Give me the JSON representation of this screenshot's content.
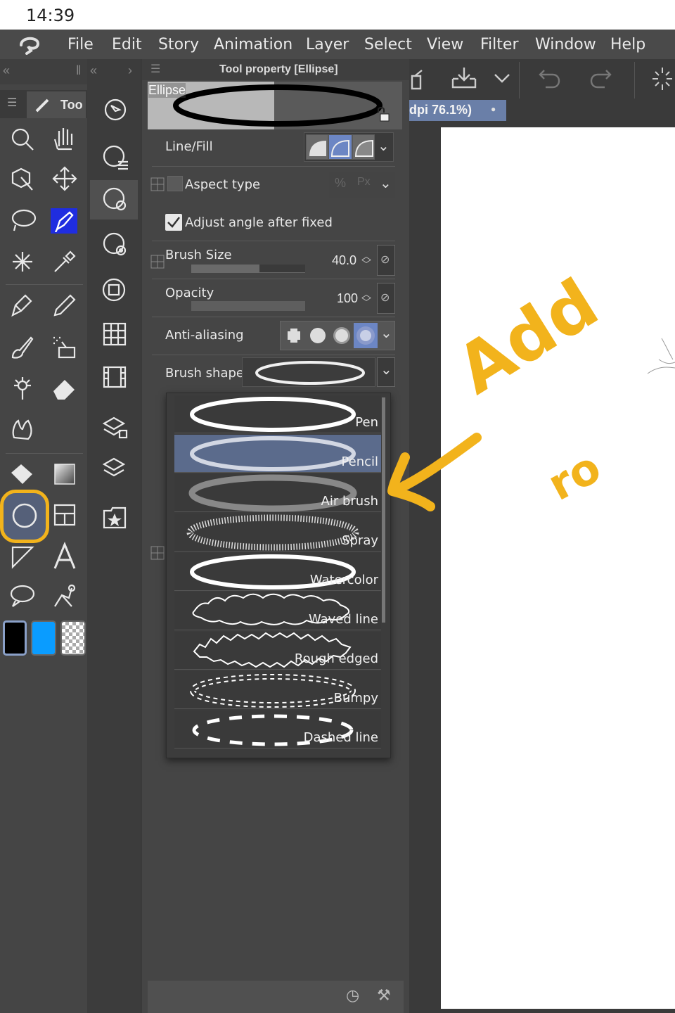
{
  "status_bar": {
    "time": "14:39"
  },
  "menu": {
    "items": [
      "File",
      "Edit",
      "Story",
      "Animation",
      "Layer",
      "Select",
      "View",
      "Filter",
      "Window",
      "Help"
    ]
  },
  "tool_palette": {
    "tab_label": "Too"
  },
  "tool_property": {
    "title": "Tool property [Ellipse]",
    "preview_label": "Ellipse",
    "line_fill_label": "Line/Fill",
    "aspect_type_label": "Aspect type",
    "adjust_angle_label": "Adjust angle after fixed",
    "adjust_angle_checked": true,
    "brush_size_label": "Brush Size",
    "brush_size_value": "40.0",
    "brush_size_fraction": 0.6,
    "opacity_label": "Opacity",
    "opacity_value": "100",
    "opacity_fraction": 1.0,
    "anti_aliasing_label": "Anti-aliasing",
    "brush_shape_label": "Brush shape",
    "brush_shapes": [
      "Pen",
      "Pencil",
      "Air brush",
      "Spray",
      "Watercolor",
      "Waved line",
      "Rough edged",
      "Bumpy",
      "Dashed line"
    ],
    "selected_brush_shape": "Pencil"
  },
  "canvas_tab": {
    "label": "dpi 76.1%)"
  },
  "annotation": {
    "text_main": "Add",
    "text_sub": "ro",
    "color": "#f2b31c"
  },
  "colors": {
    "main_color": "#000000",
    "sub_color": "#0a9cff",
    "accent": "#5b6b8c",
    "highlight": "#f2b31c"
  }
}
